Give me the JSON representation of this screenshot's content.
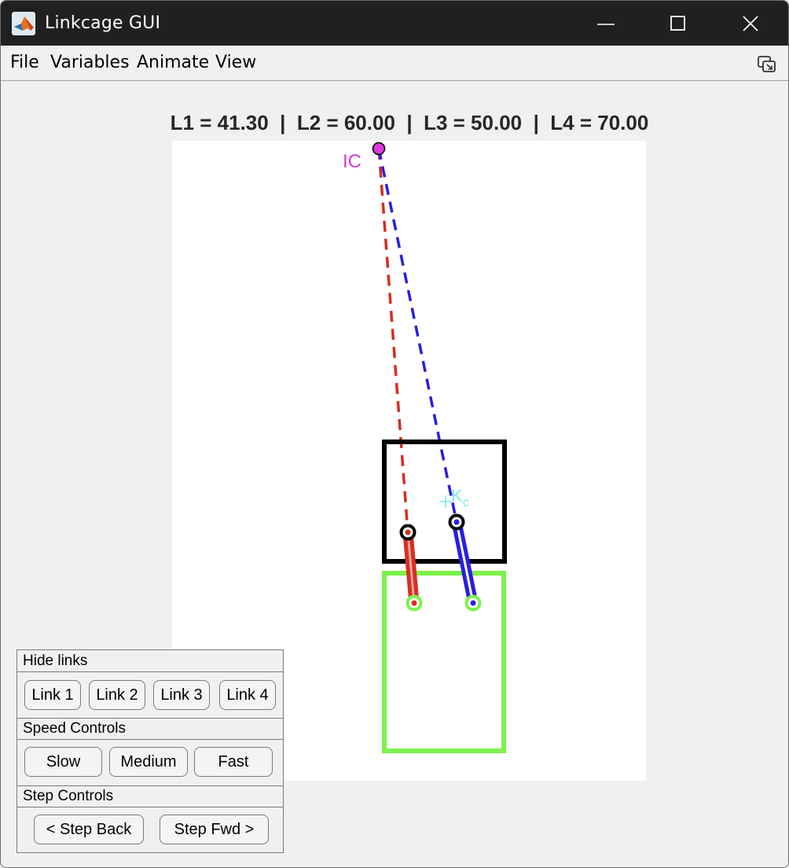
{
  "window": {
    "title": "Linkcage GUI",
    "app_icon": "matlab-icon",
    "controls": [
      "minimize-icon",
      "maximize-icon",
      "close-icon"
    ]
  },
  "menu": {
    "items": [
      "File",
      "Variables",
      "Animate",
      "View"
    ],
    "undock_icon": "undock-icon"
  },
  "lengths": {
    "text": "L1 = 41.30  |  L2 = 60.00  |  L3 = 50.00  |  L4 = 70.00"
  },
  "plot": {
    "ic_label": "IC",
    "kc_label_main": "K",
    "kc_label_sub": "c",
    "colors": {
      "link_red": "#d62e1f",
      "link_blue": "#2a1ee0",
      "ground": "#7cf24a",
      "coupler": "#000000",
      "ic": "#d93ad9",
      "kc": "#7fe6f0"
    }
  },
  "panel": {
    "hide_links": {
      "title": "Hide links",
      "buttons": [
        "Link 1",
        "Link 2",
        "Link 3",
        "Link 4"
      ]
    },
    "speed": {
      "title": "Speed Controls",
      "buttons": [
        "Slow",
        "Medium",
        "Fast"
      ]
    },
    "step": {
      "title": "Step Controls",
      "buttons": [
        "< Step Back",
        "Step Fwd >"
      ]
    }
  }
}
